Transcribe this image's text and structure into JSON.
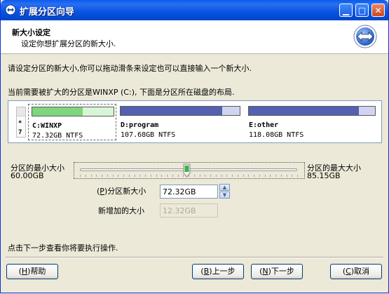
{
  "window": {
    "title": "扩展分区向导"
  },
  "header": {
    "title": "新大小设定",
    "subtitle": "设定你想扩展分区的新大小."
  },
  "instruction": "请设定分区的新大小,你可以拖动滑条来设定也可以直接输入一个新大小.",
  "layout_text": "当前需要被扩大的分区是WINXP (C:), 下面是分区所在磁盘的布局.",
  "disk": {
    "mini_marks": [
      "*",
      "7"
    ],
    "partitions": [
      {
        "name": "C:WINXP",
        "size": "72.32GB NTFS",
        "used_fraction": 0.62,
        "color": "#7ed67e",
        "selected": true
      },
      {
        "name": "D:program",
        "size": "107.68GB NTFS",
        "used_fraction": 0.85,
        "color": "#5560b0",
        "selected": false
      },
      {
        "name": "E:other",
        "size": "118.08GB NTFS",
        "used_fraction": 0.87,
        "color": "#5560b0",
        "selected": false
      }
    ]
  },
  "slider": {
    "min_label": "分区的最小大小",
    "min_value": "60.00GB",
    "max_label": "分区的最大大小",
    "max_value": "85.15GB",
    "position_fraction": 0.49
  },
  "fields": {
    "new_size_hotkey": "P",
    "new_size_label_a": "(",
    "new_size_label_b": ")分区新大小",
    "new_size_value": "72.32GB",
    "added_size_label": "新增加的大小",
    "added_size_value": "12.32GB"
  },
  "footer_text": "点击下一步查看你将要执行操作.",
  "buttons": {
    "help": {
      "hotkey": "H",
      "label": "帮助"
    },
    "back": {
      "hotkey": "B",
      "label": "上一步"
    },
    "next": {
      "hotkey": "N",
      "label": "下一步"
    },
    "cancel": {
      "hotkey": "C",
      "label": "取消"
    }
  },
  "colors": {
    "title_bar": "#0653e0",
    "accent": "#2a6ff0"
  }
}
